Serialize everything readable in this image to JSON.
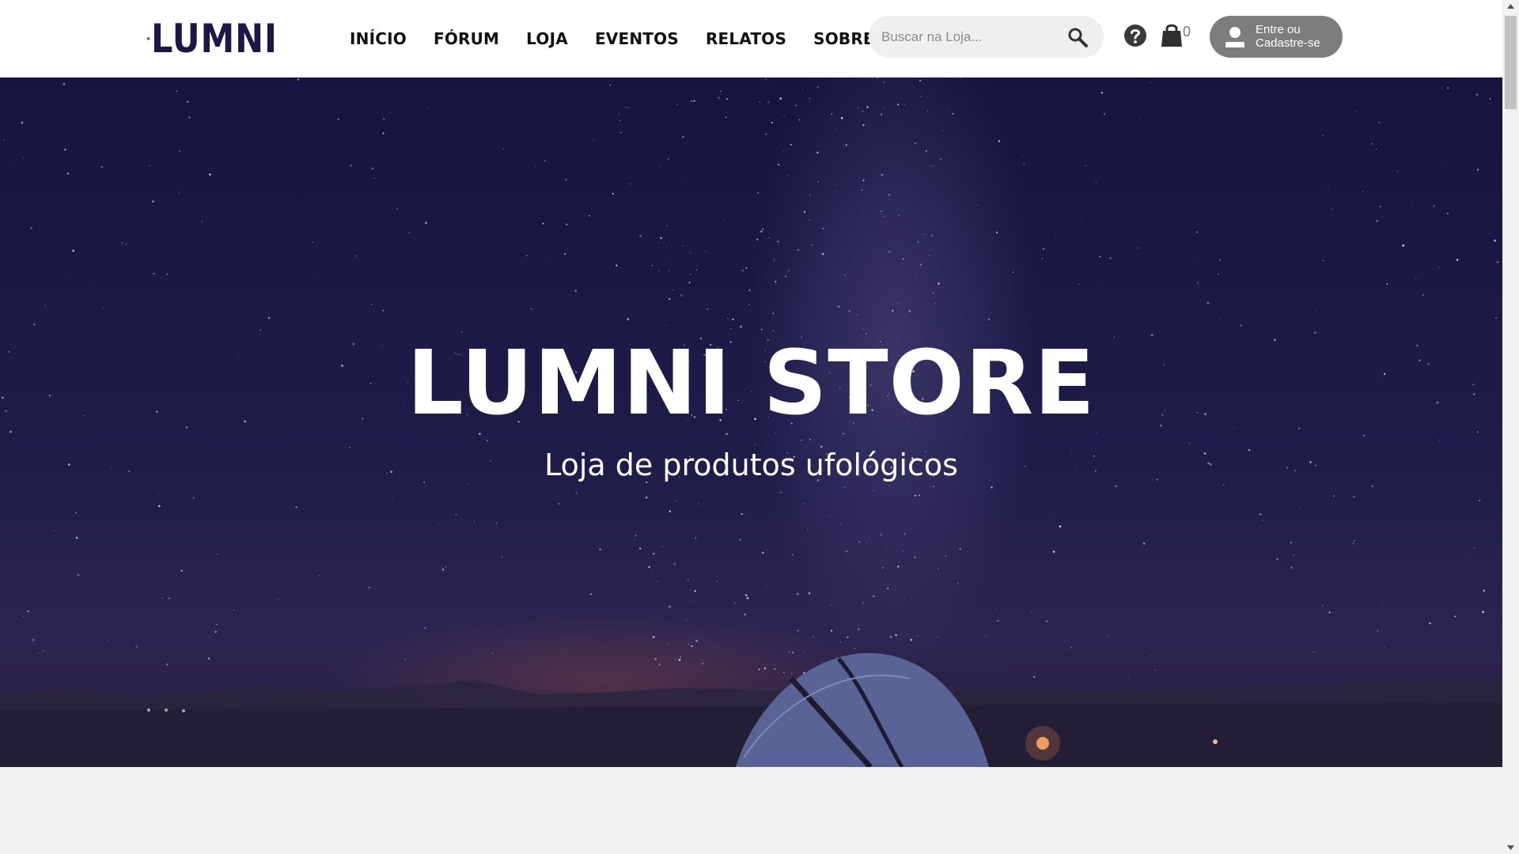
{
  "header": {
    "logo_text": "LUMNI",
    "nav": [
      {
        "label": "INÍCIO"
      },
      {
        "label": "FÓRUM"
      },
      {
        "label": "LOJA"
      },
      {
        "label": "EVENTOS"
      },
      {
        "label": "RELATOS"
      },
      {
        "label": "SOBRE NÓS"
      }
    ],
    "search": {
      "placeholder": "Buscar na Loja...",
      "value": ""
    },
    "cart_count": "0",
    "login_label": "Entre ou Cadastre-se"
  },
  "hero": {
    "title": "LUMNI STORE",
    "subtitle": "Loja de produtos ufológicos"
  },
  "colors": {
    "brand": "#1e1746",
    "header_bg": "#ffffff",
    "login_button_bg": "#7d7d7d",
    "search_bg": "#efefef",
    "page_bg": "#f0f0f0"
  },
  "icons": {
    "logo": "ufo-beam-icon",
    "search": "search-icon",
    "help": "help-circle-icon",
    "cart": "shopping-bag-icon",
    "user": "user-icon"
  }
}
